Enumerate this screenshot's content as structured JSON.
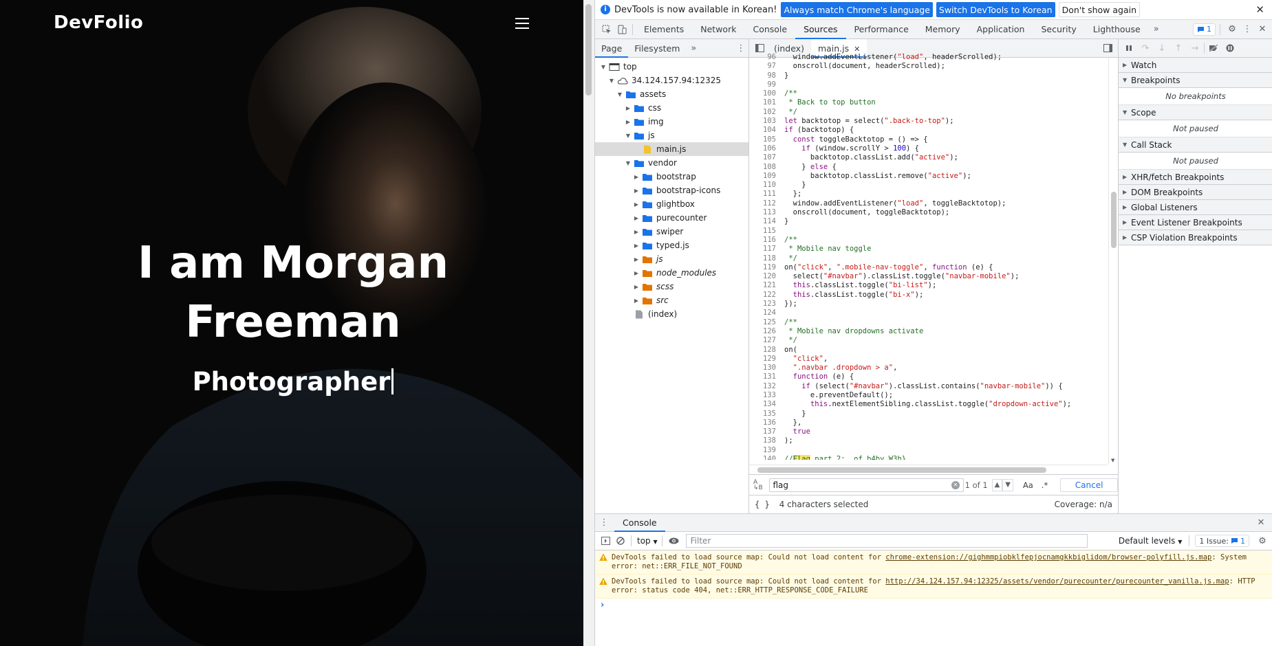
{
  "site": {
    "logo": "DevFolio",
    "hero_title_line1": "I am Morgan",
    "hero_title_line2": "Freeman",
    "hero_role": "Photographer"
  },
  "devtools": {
    "infobar": {
      "message": "DevTools is now available in Korean!",
      "btn_match": "Always match Chrome's language",
      "btn_switch": "Switch DevTools to Korean",
      "btn_dismiss": "Don't show again"
    },
    "tabs": [
      "Elements",
      "Network",
      "Console",
      "Sources",
      "Performance",
      "Memory",
      "Application",
      "Security",
      "Lighthouse"
    ],
    "active_tab": "Sources",
    "issues_badge": "1",
    "navigator": {
      "tabs": [
        "Page",
        "Filesystem"
      ],
      "tree": [
        {
          "label": "top",
          "depth": 0,
          "kind": "frame",
          "open": true
        },
        {
          "label": "34.124.157.94:12325",
          "depth": 1,
          "kind": "cloud",
          "open": true
        },
        {
          "label": "assets",
          "depth": 2,
          "kind": "folder",
          "open": true
        },
        {
          "label": "css",
          "depth": 3,
          "kind": "folder",
          "open": false
        },
        {
          "label": "img",
          "depth": 3,
          "kind": "folder",
          "open": false
        },
        {
          "label": "js",
          "depth": 3,
          "kind": "folder",
          "open": true
        },
        {
          "label": "main.js",
          "depth": 4,
          "kind": "jsfile",
          "selected": true
        },
        {
          "label": "vendor",
          "depth": 3,
          "kind": "folder",
          "open": true
        },
        {
          "label": "bootstrap",
          "depth": 4,
          "kind": "folder",
          "open": false
        },
        {
          "label": "bootstrap-icons",
          "depth": 4,
          "kind": "folder",
          "open": false
        },
        {
          "label": "glightbox",
          "depth": 4,
          "kind": "folder",
          "open": false
        },
        {
          "label": "purecounter",
          "depth": 4,
          "kind": "folder",
          "open": false
        },
        {
          "label": "swiper",
          "depth": 4,
          "kind": "folder",
          "open": false
        },
        {
          "label": "typed.js",
          "depth": 4,
          "kind": "folder",
          "open": false
        },
        {
          "label": "js",
          "depth": 4,
          "kind": "orange",
          "open": false
        },
        {
          "label": "node_modules",
          "depth": 4,
          "kind": "orange",
          "open": false
        },
        {
          "label": "scss",
          "depth": 4,
          "kind": "orange",
          "open": false
        },
        {
          "label": "src",
          "depth": 4,
          "kind": "orange",
          "open": false
        },
        {
          "label": "(index)",
          "depth": 3,
          "kind": "file"
        }
      ]
    },
    "editor": {
      "tabs": [
        "(index)",
        "main.js"
      ],
      "lines": [
        {
          "n": "96",
          "t": "  window.addEventListener(\"load\", headerScrolled);"
        },
        {
          "n": "97",
          "t": "  onscroll(document, headerScrolled);"
        },
        {
          "n": "98",
          "t": "}"
        },
        {
          "n": "99",
          "t": ""
        },
        {
          "n": "100",
          "t": "/**"
        },
        {
          "n": "101",
          "t": " * Back to top button"
        },
        {
          "n": "102",
          "t": " */"
        },
        {
          "n": "103",
          "t": "let backtotop = select(\".back-to-top\");"
        },
        {
          "n": "104",
          "t": "if (backtotop) {"
        },
        {
          "n": "105",
          "t": "  const toggleBacktotop = () => {"
        },
        {
          "n": "106",
          "t": "    if (window.scrollY > 100) {"
        },
        {
          "n": "107",
          "t": "      backtotop.classList.add(\"active\");"
        },
        {
          "n": "108",
          "t": "    } else {"
        },
        {
          "n": "109",
          "t": "      backtotop.classList.remove(\"active\");"
        },
        {
          "n": "110",
          "t": "    }"
        },
        {
          "n": "111",
          "t": "  };"
        },
        {
          "n": "112",
          "t": "  window.addEventListener(\"load\", toggleBacktotop);"
        },
        {
          "n": "113",
          "t": "  onscroll(document, toggleBacktotop);"
        },
        {
          "n": "114",
          "t": "}"
        },
        {
          "n": "115",
          "t": ""
        },
        {
          "n": "116",
          "t": "/**"
        },
        {
          "n": "117",
          "t": " * Mobile nav toggle"
        },
        {
          "n": "118",
          "t": " */"
        },
        {
          "n": "119",
          "t": "on(\"click\", \".mobile-nav-toggle\", function (e) {"
        },
        {
          "n": "120",
          "t": "  select(\"#navbar\").classList.toggle(\"navbar-mobile\");"
        },
        {
          "n": "121",
          "t": "  this.classList.toggle(\"bi-list\");"
        },
        {
          "n": "122",
          "t": "  this.classList.toggle(\"bi-x\");"
        },
        {
          "n": "123",
          "t": "});"
        },
        {
          "n": "124",
          "t": ""
        },
        {
          "n": "125",
          "t": "/**"
        },
        {
          "n": "126",
          "t": " * Mobile nav dropdowns activate"
        },
        {
          "n": "127",
          "t": " */"
        },
        {
          "n": "128",
          "t": "on("
        },
        {
          "n": "129",
          "t": "  \"click\","
        },
        {
          "n": "130",
          "t": "  \".navbar .dropdown > a\","
        },
        {
          "n": "131",
          "t": "  function (e) {"
        },
        {
          "n": "132",
          "t": "    if (select(\"#navbar\").classList.contains(\"navbar-mobile\")) {"
        },
        {
          "n": "133",
          "t": "      e.preventDefault();"
        },
        {
          "n": "134",
          "t": "      this.nextElementSibling.classList.toggle(\"dropdown-active\");"
        },
        {
          "n": "135",
          "t": "    }"
        },
        {
          "n": "136",
          "t": "  },"
        },
        {
          "n": "137",
          "t": "  true"
        },
        {
          "n": "138",
          "t": ");"
        },
        {
          "n": "139",
          "t": ""
        },
        {
          "n": "140",
          "t": "//Flag part 2: _of_b4by_W3b}"
        },
        {
          "n": "141",
          "t": ""
        }
      ],
      "search_value": "flag",
      "search_count": "1 of 1",
      "match_case_label": "Aa",
      "regex_label": ".*",
      "cancel_label": "Cancel",
      "status_braces": "{ }",
      "status_selection": "4 characters selected",
      "status_coverage": "Coverage: n/a"
    },
    "debugger": {
      "panes": [
        {
          "title": "Watch",
          "open": false
        },
        {
          "title": "Breakpoints",
          "open": true,
          "body": "No breakpoints"
        },
        {
          "title": "Scope",
          "open": true,
          "body": "Not paused"
        },
        {
          "title": "Call Stack",
          "open": true,
          "body": "Not paused"
        },
        {
          "title": "XHR/fetch Breakpoints",
          "open": false
        },
        {
          "title": "DOM Breakpoints",
          "open": false
        },
        {
          "title": "Global Listeners",
          "open": false
        },
        {
          "title": "Event Listener Breakpoints",
          "open": false
        },
        {
          "title": "CSP Violation Breakpoints",
          "open": false
        }
      ]
    },
    "console": {
      "tab": "Console",
      "context": "top",
      "filter_placeholder": "Filter",
      "levels": "Default levels",
      "issues_label": "1 Issue:",
      "issues_count": "1",
      "messages": [
        {
          "pre": "DevTools failed to load source map: Could not load content for ",
          "link": "chrome-extension://gighmmpiobklfepjocnamgkkbiglidom/browser-polyfill.js.map",
          "post": ": System error: net::ERR_FILE_NOT_FOUND"
        },
        {
          "pre": "DevTools failed to load source map: Could not load content for ",
          "link": "http://34.124.157.94:12325/assets/vendor/purecounter/purecounter_vanilla.js.map",
          "post": ": HTTP error: status code 404, net::ERR_HTTP_RESPONSE_CODE_FAILURE"
        }
      ],
      "prompt": "›"
    },
    "colors": {
      "accent": "#1a73e8",
      "folder_blue": "#1a73e8",
      "folder_orange": "#e37400",
      "js_file": "#f2c230",
      "flag_highlight": "#fbe26b"
    }
  }
}
